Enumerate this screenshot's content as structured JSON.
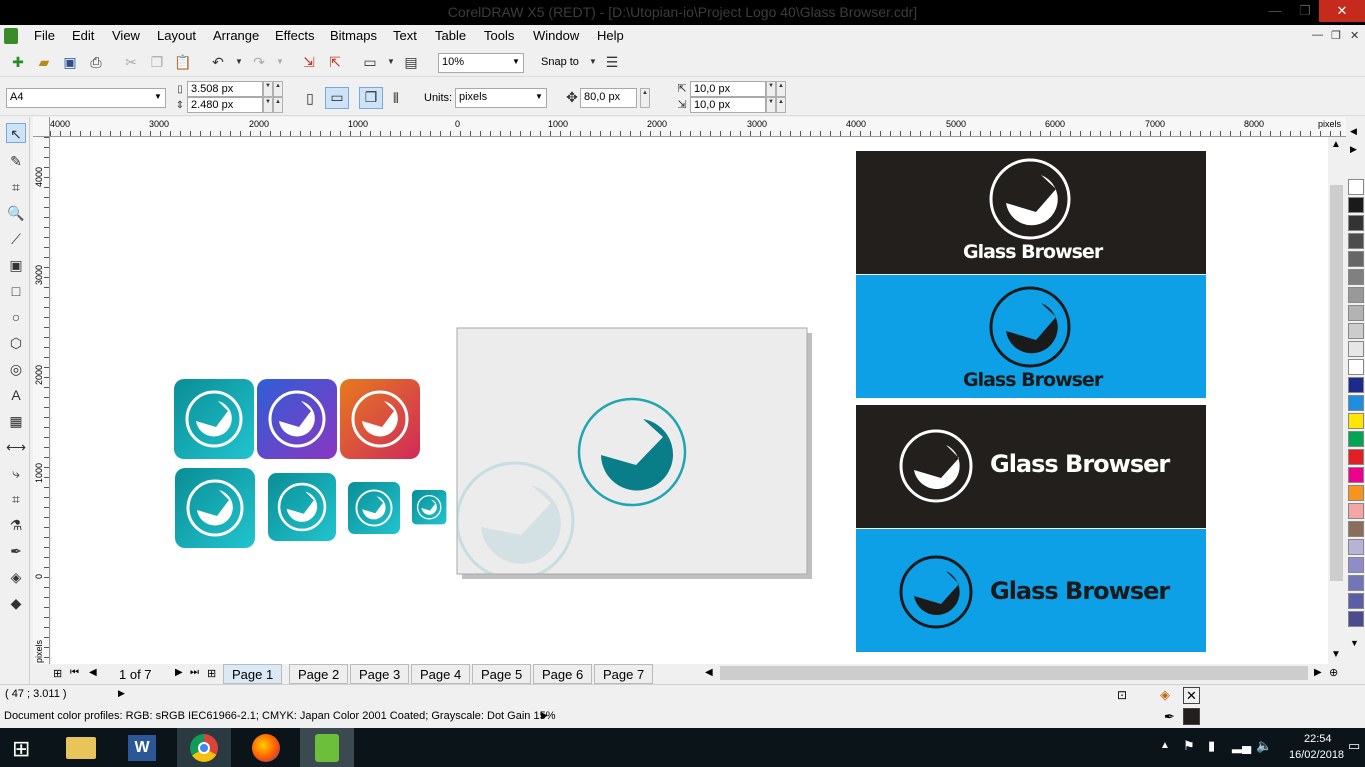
{
  "window": {
    "title": "CorelDRAW X5 (REDT) - [D:\\Utopian-io\\Project Logo 40\\Glass Browser.cdr]",
    "minimize_icon": "minimize-icon",
    "maximize_icon": "maximize-icon",
    "close_icon": "close-icon"
  },
  "menu": [
    "File",
    "Edit",
    "View",
    "Layout",
    "Arrange",
    "Effects",
    "Bitmaps",
    "Text",
    "Table",
    "Tools",
    "Window",
    "Help"
  ],
  "toolbar": {
    "zoom": "10%",
    "snap_to": "Snap to"
  },
  "property_bar": {
    "page_size": "A4",
    "width": "3.508 px",
    "height": "2.480 px",
    "units_label": "Units:",
    "units": "pixels",
    "nudge": "80,0 px",
    "dup_x": "10,0 px",
    "dup_y": "10,0 px"
  },
  "ruler": {
    "h_ticks": [
      "4000",
      "3000",
      "2000",
      "1000",
      "0",
      "1000",
      "2000",
      "3000",
      "4000",
      "5000",
      "6000",
      "7000",
      "8000"
    ],
    "h_unit": "pixels",
    "v_ticks": [
      "4000",
      "3000",
      "2000",
      "1000",
      "0"
    ],
    "v_unit": "pixels"
  },
  "canvas": {
    "brand_name": "Glass Browser",
    "accent_teal": "#0ea5a9",
    "accent_blue": "#0ea0e6",
    "dark_bg": "#231f1c"
  },
  "pages": {
    "indicator": "1 of 7",
    "tabs": [
      "Page 1",
      "Page 2",
      "Page 3",
      "Page 4",
      "Page 5",
      "Page 6",
      "Page 7"
    ]
  },
  "status": {
    "coords": "( 47   ; 3.011 )",
    "color_profiles": "Document color profiles: RGB: sRGB IEC61966-2.1; CMYK: Japan Color 2001 Coated; Grayscale: Dot Gain 15%"
  },
  "taskbar": {
    "time": "22:54",
    "date": "16/02/2018"
  },
  "palette_colors": [
    "#ffffff",
    "#1a1a1a",
    "#333333",
    "#4d4d4d",
    "#666666",
    "#808080",
    "#999999",
    "#b3b3b3",
    "#cccccc",
    "#e6e6e6",
    "#ffffff",
    "#1b2a8c",
    "#1e8fe0",
    "#ffe600",
    "#00a651",
    "#e31e24",
    "#ec008c",
    "#f7941d",
    "#f4a6a6",
    "#8b6e5a",
    "#b7b3d8",
    "#8f8cc8",
    "#7276b8",
    "#5b5ea6",
    "#4b4b8f"
  ]
}
